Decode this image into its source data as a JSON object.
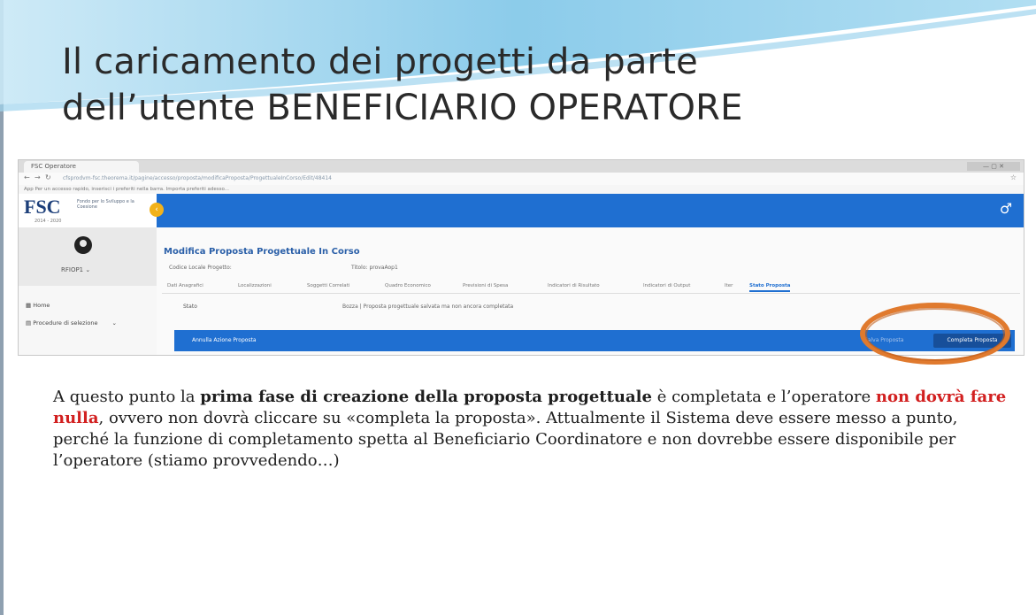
{
  "slide": {
    "title_line1": "Il caricamento dei progetti da parte",
    "title_line2": "dell’utente BENEFICIARIO OPERATORE",
    "body": {
      "p1": "A questo punto la ",
      "p2_bold": "prima fase di creazione della proposta progettuale",
      "p3": " è completata e l’operatore ",
      "p4_red": "non dovrà fare nulla",
      "p5": ", ovvero non dovrà cliccare su «completa la proposta». Attualmente il Sistema deve essere messo a punto, perché la funzione di completamento spetta al Beneficiario Coordinatore e non dovrebbe essere disponibile per l’operatore (stiamo provvedendo…)"
    },
    "colors": {
      "accent_blue": "#1f6fd1",
      "highlight_ring": "#e07a2e",
      "emphasis_red": "#d22020"
    }
  },
  "screenshot": {
    "browser_tab": "FSC Operatore",
    "url": "cfsprodvm-fsc.theorema.it/pagine/accesso/proposta/modificaProposta/ProgettualeInCorso/Edit/48414",
    "bookmarks": "App  Per un accesso rapido, inserisci i preferiti nella barra. Importa preferiti adesso...",
    "logo": {
      "text": "FSC",
      "subtitle": "Fondo per lo Sviluppo e la Coesione",
      "years": "2014 - 2020"
    },
    "icons": {
      "collapse": "chevron-left-icon",
      "user_settings": "user-gear-icon",
      "home": "home-icon",
      "procedures": "list-icon"
    },
    "sidebar": {
      "username": "RFIOP1 ⌄",
      "home_label": "Home",
      "procedures_label": "Procedure di selezione",
      "procedures_chevron": "⌄"
    },
    "page_title": "Modifica Proposta Progettuale In Corso",
    "fields": {
      "codice_locale": "Codice Locale Progetto:",
      "titolo": "Titolo: provaAop1"
    },
    "tabs": [
      "Dati Anagrafici",
      "Localizzazioni",
      "Soggetti Correlati",
      "Quadro Economico",
      "Previsioni di Spesa",
      "Indicatori di Risultato",
      "Indicatori di Output",
      "Iter",
      "Stato Proposta"
    ],
    "active_tab": "Stato Proposta",
    "state": {
      "label": "Stato",
      "value": "Bozza | Proposta progettuale salvata ma non ancora completata"
    },
    "actions": {
      "cancel": "Annulla Azione Proposta",
      "save": "Salva Proposta",
      "complete": "Completa Proposta"
    }
  }
}
